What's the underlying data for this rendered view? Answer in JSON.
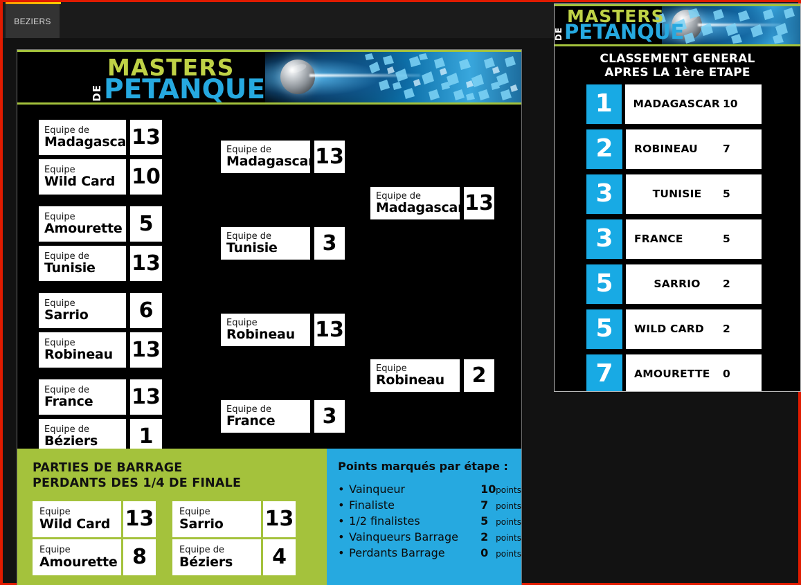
{
  "browser": {
    "tab_label": "BEZIERS"
  },
  "logo": {
    "masters": "MASTERS",
    "de": "DE",
    "petanque": "PETANQUE",
    "colors": {
      "green": "#a4c23c",
      "blue": "#26a9e0",
      "rank_blue": "#18aae4",
      "red_border": "#e01b00"
    }
  },
  "bracket": {
    "prefix_de": "Equipe de",
    "prefix_plain": "Equipe",
    "round1": [
      {
        "prefix": "Equipe de",
        "name": "Madagascar",
        "score": "13"
      },
      {
        "prefix": "Equipe",
        "name": "Wild Card",
        "score": "10"
      },
      {
        "prefix": "Equipe",
        "name": "Amourette",
        "score": "5"
      },
      {
        "prefix": "Equipe de",
        "name": "Tunisie",
        "score": "13"
      },
      {
        "prefix": "Equipe",
        "name": "Sarrio",
        "score": "6"
      },
      {
        "prefix": "Equipe",
        "name": "Robineau",
        "score": "13"
      },
      {
        "prefix": "Equipe de",
        "name": "France",
        "score": "13"
      },
      {
        "prefix": "Equipe de",
        "name": "Béziers",
        "score": "1"
      }
    ],
    "semis": [
      {
        "prefix": "Equipe de",
        "name": "Madagascar",
        "score": "13"
      },
      {
        "prefix": "Equipe de",
        "name": "Tunisie",
        "score": "3"
      },
      {
        "prefix": "Equipe",
        "name": "Robineau",
        "score": "13"
      },
      {
        "prefix": "Equipe de",
        "name": "France",
        "score": "3"
      }
    ],
    "final": [
      {
        "prefix": "Equipe de",
        "name": "Madagascar",
        "score": "13"
      },
      {
        "prefix": "Equipe",
        "name": "Robineau",
        "score": "2"
      }
    ]
  },
  "barrage": {
    "title_line1": "PARTIES DE BARRAGE",
    "title_line2": "PERDANTS DES 1/4 DE FINALE",
    "groups": [
      [
        {
          "prefix": "Equipe",
          "name": "Wild Card",
          "score": "13"
        },
        {
          "prefix": "Equipe",
          "name": "Amourette",
          "score": "8"
        }
      ],
      [
        {
          "prefix": "Equipe",
          "name": "Sarrio",
          "score": "13"
        },
        {
          "prefix": "Equipe de",
          "name": "Béziers",
          "score": "4"
        }
      ]
    ]
  },
  "points": {
    "title": "Points marqués par étape :",
    "unit": "points",
    "rows": [
      {
        "label": "Vainqueur",
        "value": "10"
      },
      {
        "label": "Finaliste",
        "value": "7"
      },
      {
        "label": "1/2 finalistes",
        "value": "5"
      },
      {
        "label": "Vainqueurs Barrage",
        "value": "2"
      },
      {
        "label": "Perdants Barrage",
        "value": "0"
      }
    ]
  },
  "ranking": {
    "title_line1": "CLASSEMENT GENERAL",
    "title_line2": "APRES LA 1ère ETAPE",
    "rows": [
      {
        "rank": "1",
        "team": "MADAGASCAR",
        "points": "10"
      },
      {
        "rank": "2",
        "team": "ROBINEAU",
        "points": "7"
      },
      {
        "rank": "3",
        "team": "TUNISIE",
        "points": "5"
      },
      {
        "rank": "3",
        "team": "FRANCE",
        "points": "5"
      },
      {
        "rank": "5",
        "team": "SARRIO",
        "points": "2"
      },
      {
        "rank": "5",
        "team": "WILD CARD",
        "points": "2"
      },
      {
        "rank": "7",
        "team": "AMOURETTE",
        "points": "0"
      }
    ]
  }
}
